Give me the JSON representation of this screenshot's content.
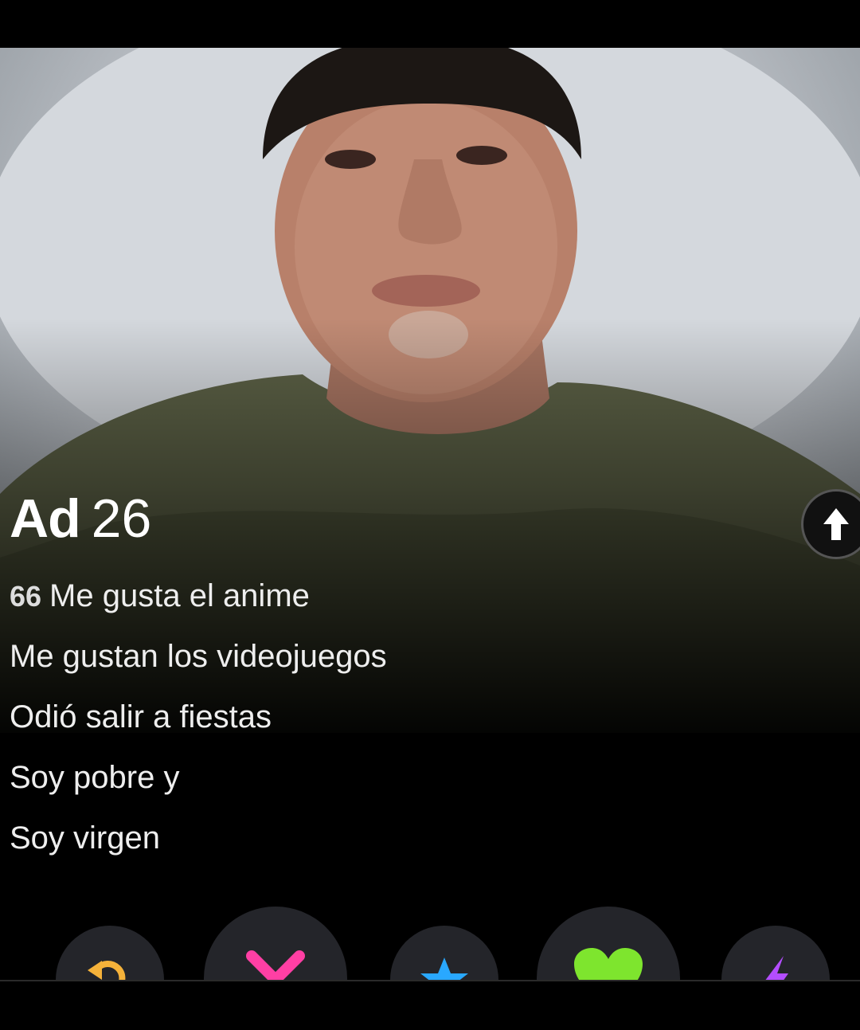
{
  "profile": {
    "name": "Ad",
    "age": "26"
  },
  "bio": {
    "quote_mark": "66",
    "lines": [
      "Me gusta el anime",
      "Me gustan los videojuegos",
      "Odió salir a fiestas",
      "Soy pobre y",
      "Soy virgen"
    ]
  },
  "actions": {
    "rewind": {
      "icon": "rewind-icon",
      "color": "#f5b23a"
    },
    "nope": {
      "icon": "x-icon",
      "color": "#ff3fa4"
    },
    "super_like": {
      "icon": "star-icon",
      "color": "#29a8ff"
    },
    "like": {
      "icon": "heart-icon",
      "color": "#7ee52e"
    },
    "boost": {
      "icon": "lightning-icon",
      "color": "#b34dff"
    }
  },
  "info_button": {
    "icon": "arrow-up-icon"
  }
}
